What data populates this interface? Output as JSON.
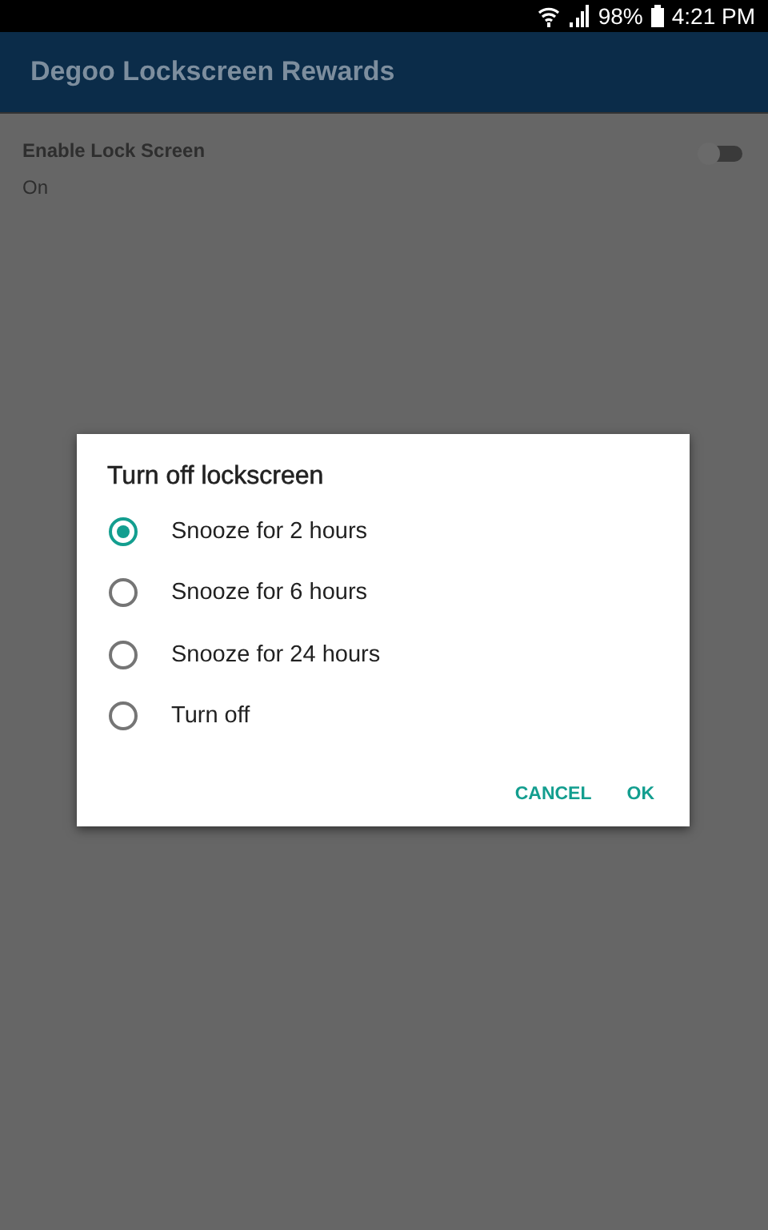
{
  "status_bar": {
    "battery": "98%",
    "time": "4:21 PM"
  },
  "app_bar": {
    "title": "Degoo Lockscreen Rewards"
  },
  "setting": {
    "title": "Enable Lock Screen",
    "summary": "On",
    "on": false
  },
  "dialog": {
    "title": "Turn off lockscreen",
    "options": [
      {
        "label": "Snooze for 2 hours",
        "selected": true
      },
      {
        "label": "Snooze for 6 hours",
        "selected": false
      },
      {
        "label": "Snooze for 24 hours",
        "selected": false
      },
      {
        "label": "Turn off",
        "selected": false
      }
    ],
    "buttons": [
      "CANCEL",
      "OK"
    ]
  }
}
